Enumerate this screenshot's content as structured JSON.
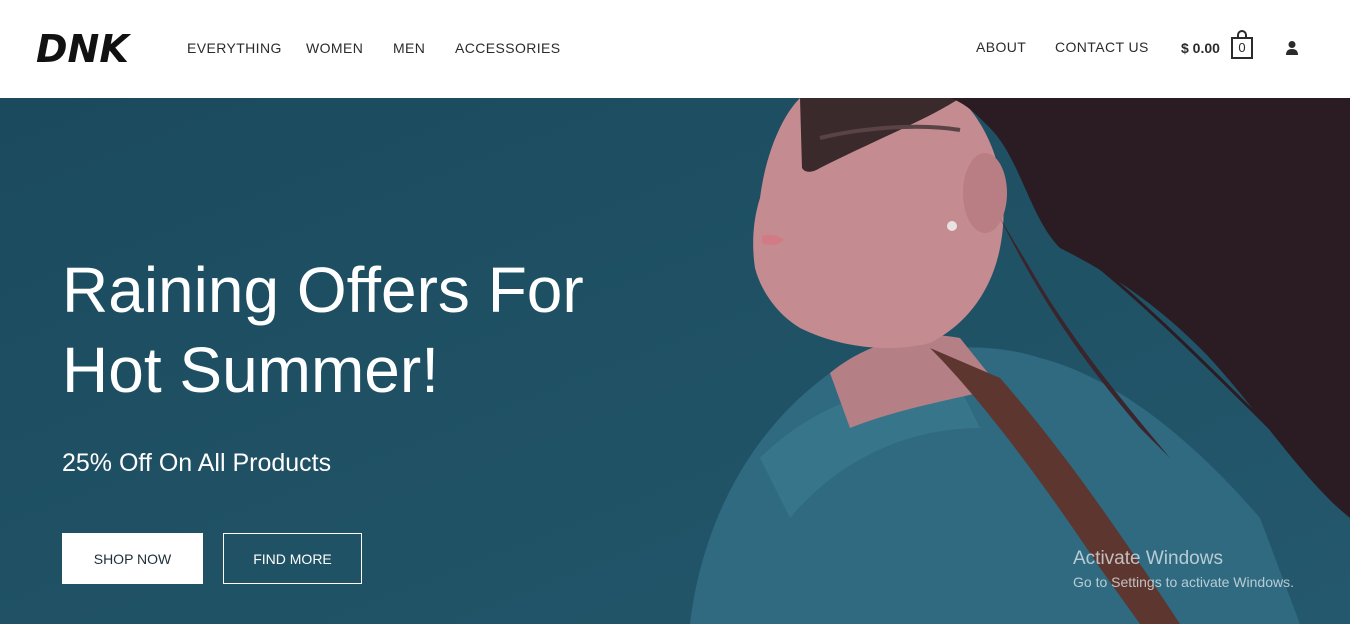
{
  "header": {
    "logo_text": "DNK",
    "nav_left": [
      "EVERYTHING",
      "WOMEN",
      "MEN",
      "ACCESSORIES"
    ],
    "nav_right": [
      "ABOUT",
      "CONTACT US"
    ],
    "cart_total": "$ 0.00",
    "cart_count": "0",
    "icons": {
      "cart": "shopping-bag-icon",
      "account": "user-icon"
    }
  },
  "hero": {
    "title_line1": "Raining Offers For",
    "title_line2": "Hot Summer!",
    "subtitle": "25% Off On All Products",
    "buttons": {
      "shop": "SHOP NOW",
      "find": "FIND MORE"
    },
    "background_color": "#1f4e62"
  },
  "watermark": {
    "title": "Activate Windows",
    "subtitle": "Go to Settings to activate Windows."
  },
  "colors": {
    "text_dark": "#2b2b2b",
    "hero_bg": "#1f4e62",
    "white": "#ffffff"
  }
}
